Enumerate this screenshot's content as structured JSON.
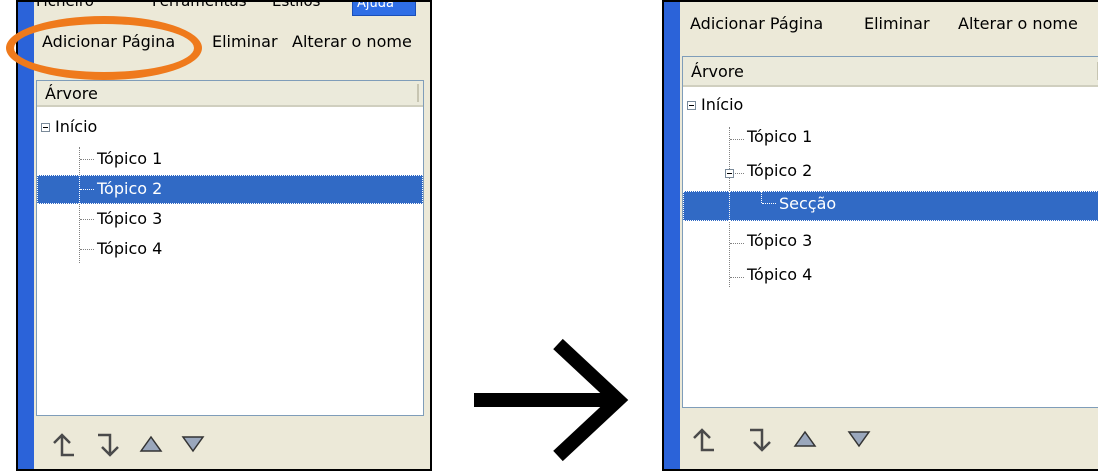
{
  "left_panel": {
    "tabs": [
      "Ficheiro",
      "Ferramentas",
      "Estilos",
      "Ajuda"
    ],
    "toolbar": {
      "add_page": "Adicionar Página",
      "delete": "Eliminar",
      "rename": "Alterar o nome"
    },
    "tree": {
      "header": "Árvore",
      "root": "Início",
      "items": [
        {
          "label": "Tópico 1",
          "selected": false
        },
        {
          "label": "Tópico 2",
          "selected": true
        },
        {
          "label": "Tópico 3",
          "selected": false
        },
        {
          "label": "Tópico 4",
          "selected": false
        }
      ]
    }
  },
  "right_panel": {
    "toolbar": {
      "add_page": "Adicionar Página",
      "delete": "Eliminar",
      "rename": "Alterar o nome"
    },
    "tree": {
      "header": "Árvore",
      "root": "Início",
      "items": [
        {
          "label": "Tópico 1",
          "selected": false
        },
        {
          "label": "Tópico 2",
          "selected": false,
          "expanded": true
        },
        {
          "label": "Secção",
          "selected": true,
          "child_of": "Tópico 2"
        },
        {
          "label": "Tópico 3",
          "selected": false
        },
        {
          "label": "Tópico 4",
          "selected": false
        }
      ]
    }
  },
  "colors": {
    "highlight_circle": "#ef7a1c",
    "selection": "#316ac5",
    "window_blue": "#2b63d9"
  },
  "icons": [
    "promote-page-icon",
    "demote-page-icon",
    "move-up-icon",
    "move-down-icon"
  ]
}
